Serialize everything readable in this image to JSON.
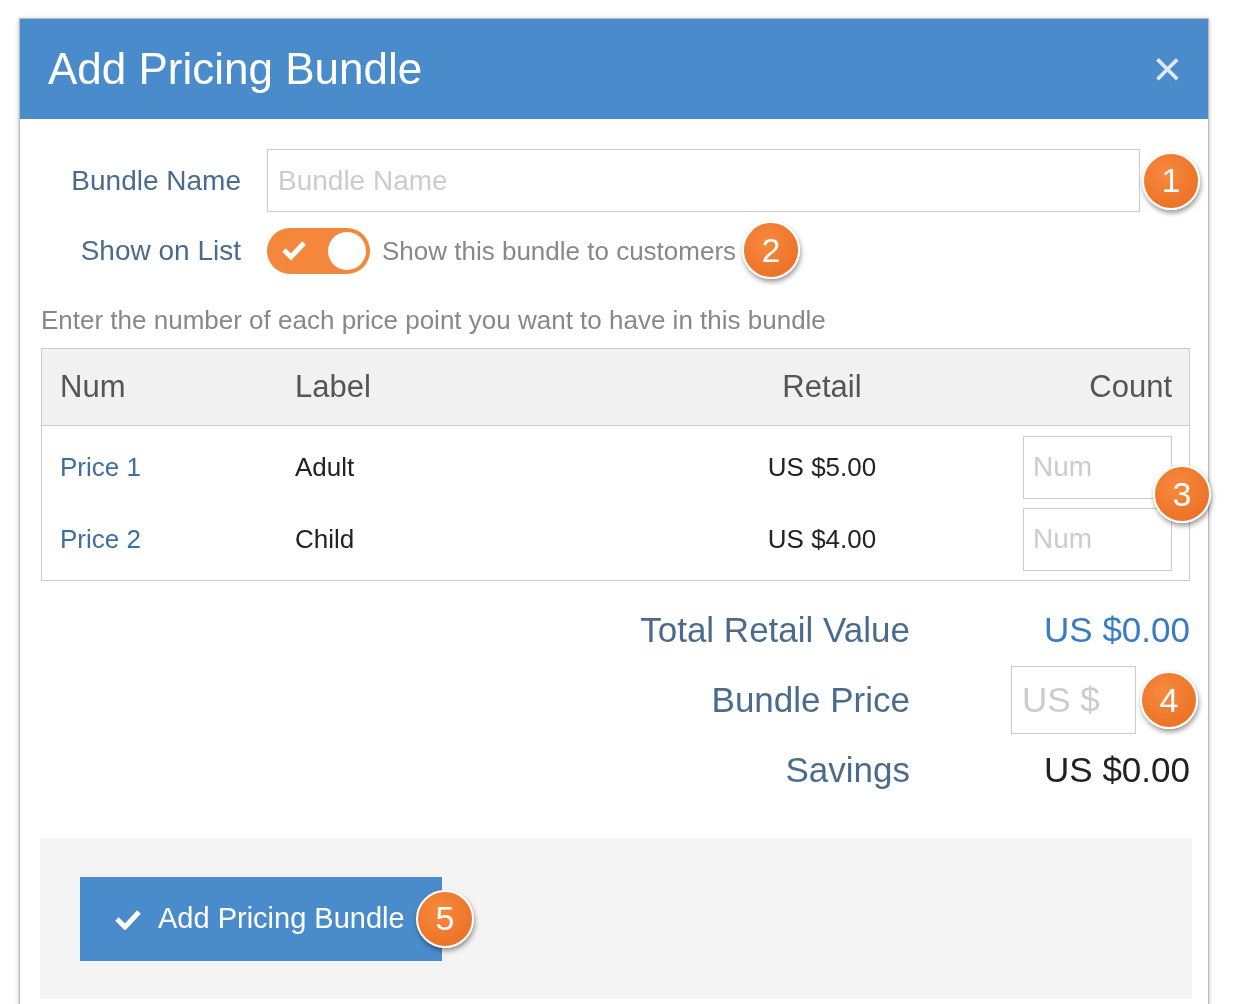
{
  "dialog": {
    "title": "Add Pricing Bundle",
    "close": "×"
  },
  "bundle_name": {
    "label": "Bundle Name",
    "placeholder": "Bundle Name",
    "callout": "1"
  },
  "show_on_list": {
    "label": "Show on List",
    "on": true,
    "description": "Show this bundle to customers",
    "callout": "2"
  },
  "instructions": "Enter the number of each price point you want to have in this bundle",
  "table": {
    "columns": [
      "Num",
      "Label",
      "Retail",
      "Count"
    ],
    "rows": [
      {
        "num": "Price 1",
        "label": "Adult",
        "retail": "US $5.00",
        "count_placeholder": "Num"
      },
      {
        "num": "Price 2",
        "label": "Child",
        "retail": "US $4.00",
        "count_placeholder": "Num"
      }
    ],
    "callout": "3"
  },
  "totals": {
    "total_label": "Total Retail Value",
    "total_value": "US $0.00",
    "price_label": "Bundle Price",
    "price_placeholder": "US $",
    "price_callout": "4",
    "savings_label": "Savings",
    "savings_value": "US $0.00"
  },
  "footer": {
    "button": "Add Pricing Bundle",
    "callout": "5"
  }
}
